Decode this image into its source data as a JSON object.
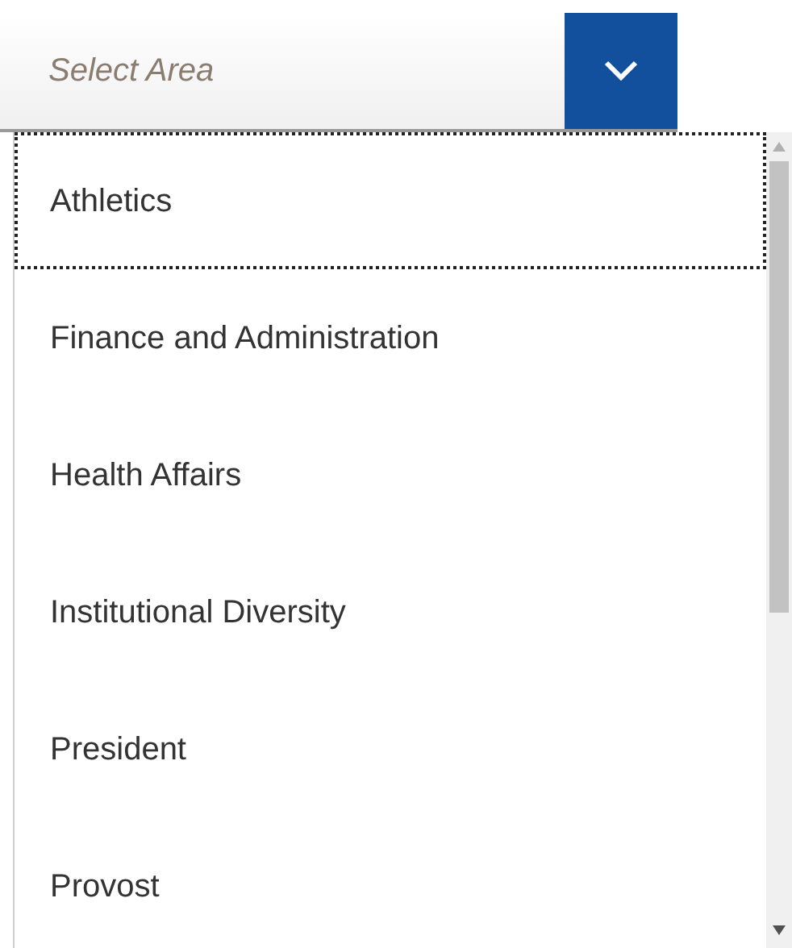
{
  "select": {
    "placeholder": "Select Area"
  },
  "options": [
    {
      "label": "Athletics",
      "selected": true
    },
    {
      "label": "Finance and Administration",
      "selected": false
    },
    {
      "label": "Health Affairs",
      "selected": false
    },
    {
      "label": "Institutional Diversity",
      "selected": false
    },
    {
      "label": "President",
      "selected": false
    },
    {
      "label": "Provost",
      "selected": false
    }
  ]
}
